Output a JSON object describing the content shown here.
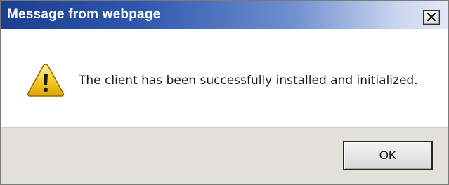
{
  "dialog": {
    "title": "Message from webpage",
    "message": "The client has been successfully installed and initialized.",
    "icon": "warning-icon",
    "ok_label": "OK",
    "close_label": "X"
  },
  "colors": {
    "titlebar_start": "#1b3f90",
    "titlebar_end": "#e3e9f6",
    "footer_background": "#e3e1dc",
    "warning_fill": "#f5c518"
  }
}
